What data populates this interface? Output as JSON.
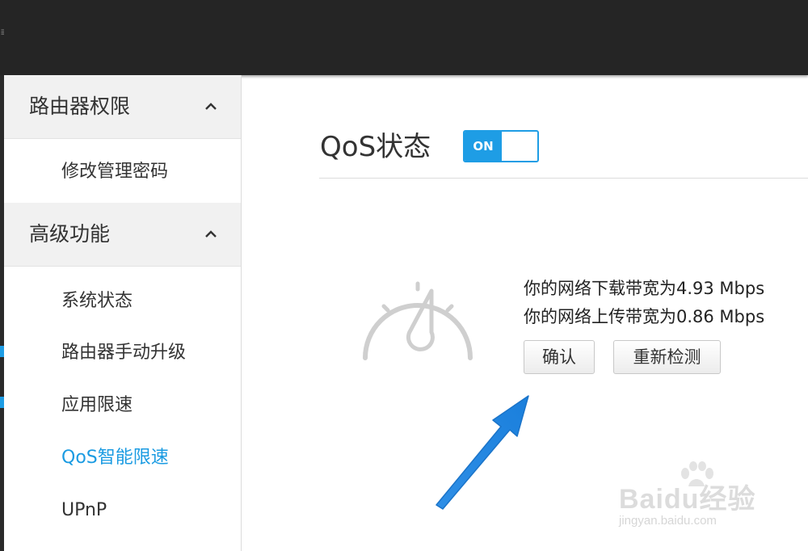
{
  "sidebar": {
    "groups": [
      {
        "label": "路由器权限",
        "items": [
          "修改管理密码"
        ]
      },
      {
        "label": "高级功能",
        "items": [
          "系统状态",
          "路由器手动升级",
          "应用限速",
          "QoS智能限速",
          "UPnP"
        ]
      }
    ],
    "active_item": "QoS智能限速"
  },
  "main": {
    "title": "QoS状态",
    "toggle_label": "ON",
    "download_text": "你的网络下载带宽为4.93 Mbps",
    "upload_text": "你的网络上传带宽为0.86 Mbps",
    "confirm_label": "确认",
    "retest_label": "重新检测"
  },
  "watermark": {
    "brand": "Baidu经验",
    "url": "jingyan.baidu.com"
  },
  "icons": [
    "chevron-up-icon",
    "speedometer-icon",
    "pointer-arrow-icon",
    "paw-icon"
  ],
  "colors": {
    "accent": "#1e9de5",
    "topbar": "#252525",
    "group_bg": "#f1f1f1",
    "active_text": "#1a9be2"
  }
}
